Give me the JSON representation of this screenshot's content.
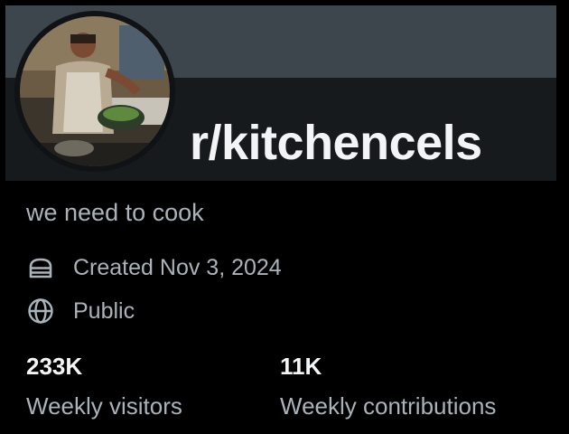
{
  "community": {
    "name": "r/kitchencels",
    "description": "we need to cook",
    "created": "Created Nov 3, 2024",
    "visibility": "Public"
  },
  "stats": [
    {
      "value": "233K",
      "label": "Weekly visitors"
    },
    {
      "value": "11K",
      "label": "Weekly contributions"
    }
  ],
  "icons": {
    "created": "cake-icon",
    "visibility": "globe-icon"
  },
  "colors": {
    "banner_top": "#3e464d",
    "banner_bottom": "#161a1d",
    "text_primary": "#f2f4f5",
    "text_secondary": "#aab3ba",
    "background": "#000000"
  }
}
